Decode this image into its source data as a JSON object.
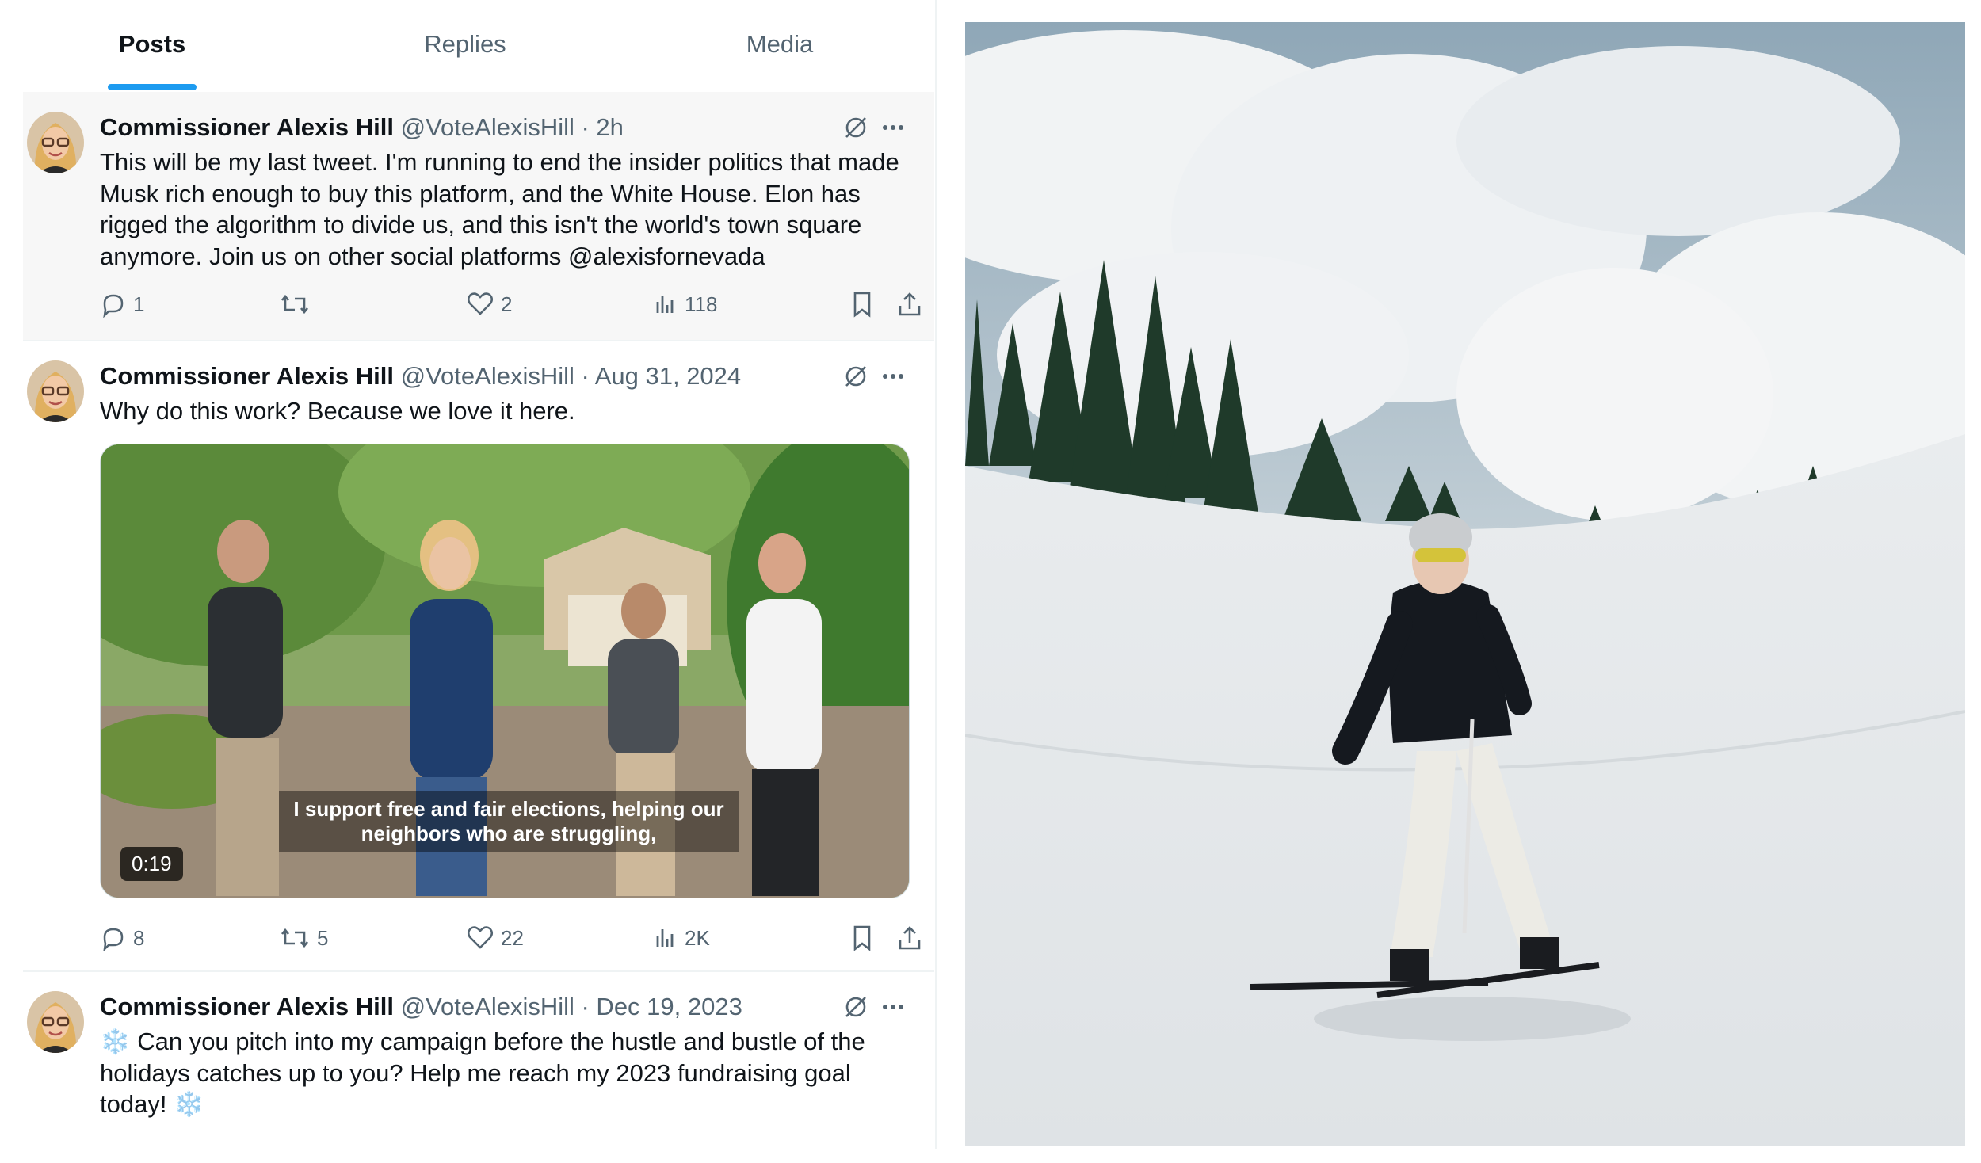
{
  "tabs": [
    {
      "label": "Posts",
      "active": true
    },
    {
      "label": "Replies",
      "active": false
    },
    {
      "label": "Media",
      "active": false
    }
  ],
  "posts": [
    {
      "author": "Commissioner Alexis Hill",
      "meta": "@VoteAlexisHill · 2h",
      "text": "This will be my last tweet. I'm running to end the insider politics that made Musk rich enough to buy this platform, and the White House. Elon has rigged the algorithm to divide us, and this isn't the world's town square anymore. Join us on other social platforms @alexisfornevada",
      "replies": "1",
      "reposts": "",
      "likes": "2",
      "views": "118"
    },
    {
      "author": "Commissioner Alexis Hill",
      "meta": "@VoteAlexisHill · Aug 31, 2024",
      "text": "Why do this work? Because we love it here.",
      "video_caption": "I support free and fair elections, helping our neighbors who are struggling,",
      "video_duration": "0:19",
      "replies": "8",
      "reposts": "5",
      "likes": "22",
      "views": "2K"
    },
    {
      "author": "Commissioner Alexis Hill",
      "meta": "@VoteAlexisHill · Dec 19, 2023",
      "text": "❄️ Can you pitch into my campaign before the hustle and bustle of the holidays catches up to you? Help me reach my 2023 fundraising goal today! ❄️"
    }
  ],
  "icons": {
    "grok": "grok-icon",
    "more": "more-icon",
    "reply": "reply-icon",
    "repost": "repost-icon",
    "like": "heart-icon",
    "views": "views-icon",
    "bookmark": "bookmark-icon",
    "share": "share-icon"
  },
  "colors": {
    "accent": "#1d9bf0",
    "text": "#0f1419",
    "secondary": "#536471",
    "highlight_bg": "#f7f7f7"
  }
}
